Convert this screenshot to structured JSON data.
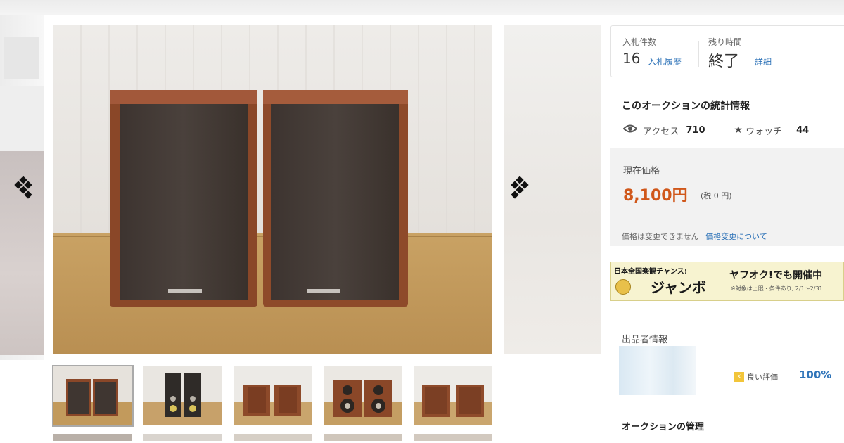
{
  "bid_info": {
    "bid_count_label": "入札件数",
    "bid_count": "16",
    "bid_history_link": "入札履歴",
    "time_left_label": "残り時間",
    "time_left": "終了",
    "details_link": "詳細"
  },
  "stats": {
    "title": "このオークションの統計情報",
    "access_label": "アクセス",
    "access_count": "710",
    "watch_label": "ウォッチ",
    "watch_count": "44"
  },
  "price": {
    "label": "現在価格",
    "value": "8,100円",
    "tax": "(税 0 円)",
    "change_note": "価格は変更できません",
    "change_link": "価格変更について"
  },
  "banner": {
    "line1": "日本全国楽観チャンス!",
    "jumbo": "ジャンボ",
    "right": "ヤフオク!でも開催中",
    "fine_print": "※対象は上限・条件あり, 2/1～2/31"
  },
  "seller": {
    "title": "出品者情報",
    "rating_label": "良い評価",
    "rating_pct": "100%",
    "management_title": "オークションの管理"
  },
  "gallery": {
    "prev_glyph": "‹",
    "next_glyph": "›",
    "thumbnails": [
      "front",
      "back-terminals",
      "front-pair",
      "front-no-grille",
      "side-pair"
    ]
  },
  "colors": {
    "price": "#d0571a",
    "link": "#2e73b8",
    "wood": "#8d4a2a",
    "grille": "#3a312d"
  }
}
